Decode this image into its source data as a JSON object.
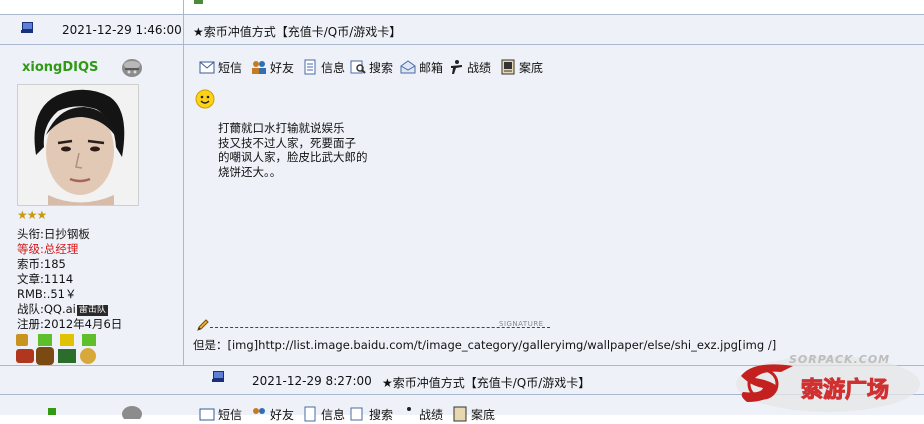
{
  "post1": {
    "date": "2021-12-29 1:46:00",
    "title": "★索币冲值方式【充值卡/Q币/游戏卡】",
    "username": "xiongDIQS",
    "user_info": {
      "rank_label": "头衔:",
      "rank_value": "日抄钢板",
      "level_label": "等级:",
      "level_value": "总经理",
      "coins_label": "索币:",
      "coins_value": "185",
      "posts_label": "文章:",
      "posts_value": "1114",
      "rmb_label": "RMB:",
      "rmb_value": ".51￥",
      "team_label": "战队:",
      "team_value": "QQ.ai",
      "team_badge": "雷击队",
      "reg_label": "注册:",
      "reg_value": "2012年4月6日"
    },
    "toolbar": [
      "短信",
      "好友",
      "信息",
      "搜索",
      "邮箱",
      "战绩",
      "案底"
    ],
    "body_lines": [
      "打薾就口水打输就说娱乐",
      "技又技不过人家，死要面子",
      "的嘲讽人家，脸皮比武大郎的",
      "烧饼还大。。"
    ],
    "signature_label": "SIGNATURE",
    "signature_text": "但是：[img]http://list.image.baidu.com/t/image_category/galleryimg/wallpaper/else/shi_exz.jpg[img /]"
  },
  "post2": {
    "date": "2021-12-29 8:27:00",
    "title": "★索币冲值方式【充值卡/Q币/游戏卡】",
    "toolbar": [
      "短信",
      "好友",
      "信息",
      "搜索",
      "战绩",
      "案底"
    ]
  },
  "watermark": {
    "top": "SORPACK.COM",
    "bottom": "索游广场"
  },
  "colors": {
    "border": "#a9b8cf",
    "header_bg": "#eef2f8",
    "username": "#2f9a12",
    "level": "#d81818"
  }
}
